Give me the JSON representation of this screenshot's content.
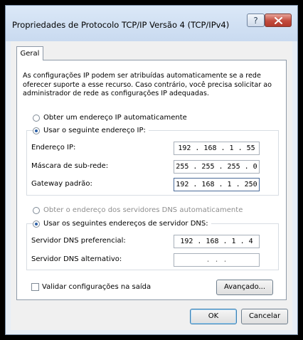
{
  "window": {
    "title": "Propriedades de Protocolo TCP/IP Versão 4 (TCP/IPv4)",
    "help_label": "?"
  },
  "tabs": [
    {
      "label": "Geral"
    }
  ],
  "intro_text": "As configurações IP podem ser atribuídas automaticamente se a rede oferecer suporte a esse recurso. Caso contrário, você precisa solicitar ao administrador de rede as configurações IP adequadas.",
  "ip_section": {
    "auto_label": "Obter um endereço IP automaticamente",
    "manual_label": "Usar o seguinte endereço IP:",
    "selected": "manual",
    "fields": [
      {
        "label": "Endereço IP:",
        "value": "192 . 168 .  1  . 55"
      },
      {
        "label": "Máscara de sub-rede:",
        "value": "255 . 255 . 255 .  0"
      },
      {
        "label": "Gateway padrão:",
        "value": "192 . 168 .  1  . 250"
      }
    ]
  },
  "dns_section": {
    "auto_label": "Obter o endereço dos servidores DNS automaticamente",
    "manual_label": "Usar os seguintes endereços de servidor DNS:",
    "selected": "manual",
    "fields": [
      {
        "label": "Servidor DNS preferencial:",
        "value": "192 . 168 .  1  .  4"
      },
      {
        "label": "Servidor DNS alternativo:",
        "value": " .    .    . "
      }
    ]
  },
  "validate_label": "Validar configurações na saída",
  "validate_checked": false,
  "buttons": {
    "advanced": "Avançado...",
    "ok": "OK",
    "cancel": "Cancelar"
  },
  "colors": {
    "titlebar": "#c9daf0",
    "close_button": "#c24b3d",
    "radio_accent": "#2b5fa6"
  }
}
